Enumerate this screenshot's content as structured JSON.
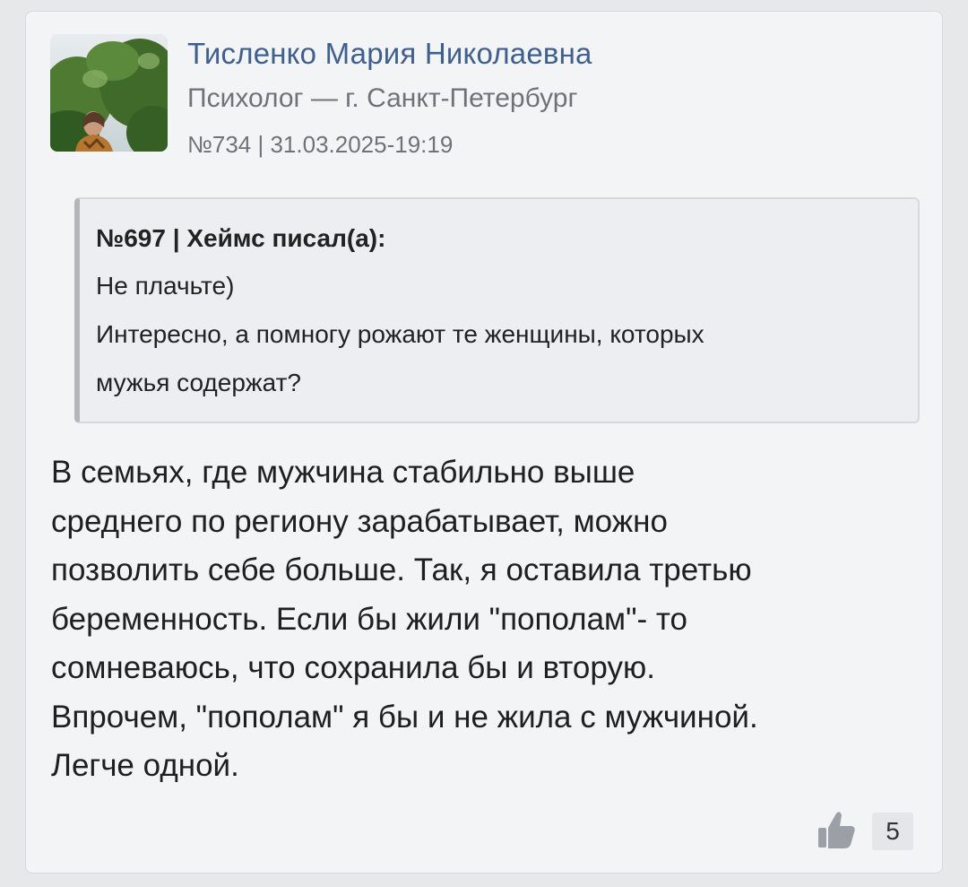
{
  "post": {
    "author": {
      "name": "Тисленко Мария Николаевна",
      "role": "Психолог — г. Санкт-Петербург"
    },
    "meta": "№734 | 31.03.2025-19:19",
    "quote": {
      "header": "№697 | Хеймс писал(а):",
      "lines": [
        "Не плачьте)",
        "Интересно, а помногу рожают те женщины, которых",
        "мужья содержат?"
      ]
    },
    "body_lines": [
      "В семьях, где мужчина стабильно выше",
      "среднего по региону зарабатывает, можно",
      "позволить себе больше. Так, я оставила третью",
      "беременность. Если бы жили \"пополам\"- то",
      "сомневаюсь, что сохранила бы и вторую.",
      "Впрочем, \"пополам\" я бы и не жила с мужчиной.",
      "Легче одной."
    ],
    "likes": {
      "icon": "thumbs-up-icon",
      "count": "5"
    }
  },
  "colors": {
    "author_name": "#3f5f8f",
    "muted_text": "#6f7378",
    "card_bg": "#f3f4f6",
    "quote_bg": "#eceef1"
  }
}
